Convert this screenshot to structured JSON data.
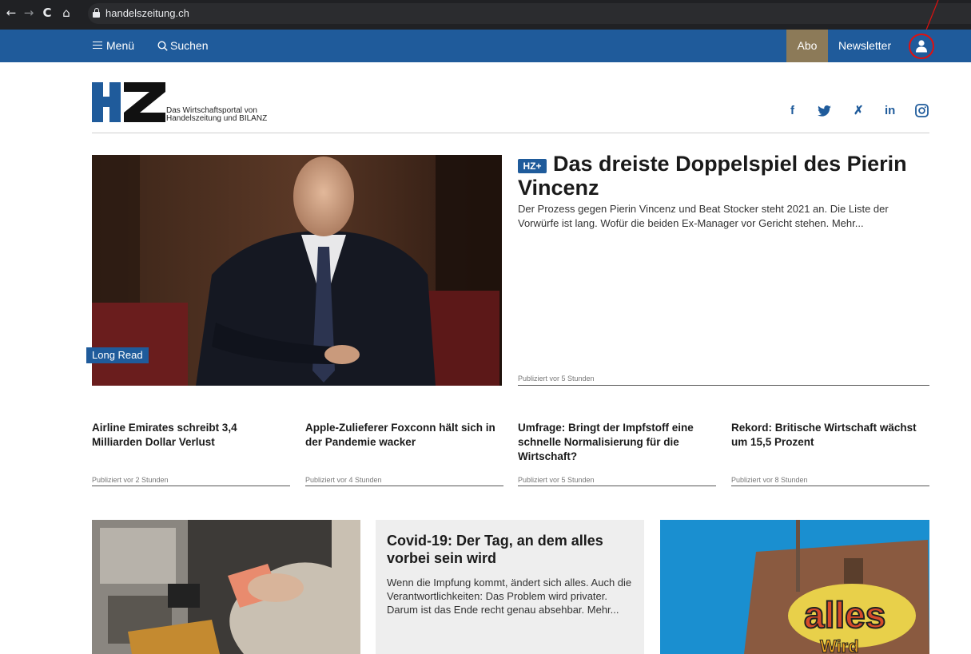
{
  "browser": {
    "url": "handelszeitung.ch",
    "back": "←",
    "forward": "→",
    "reload": "C",
    "home": "⌂"
  },
  "nav": {
    "menu": "Menü",
    "search": "Suchen",
    "abo": "Abo",
    "newsletter": "Newsletter"
  },
  "brand": {
    "logo_text": "HZ",
    "tagline_line1": "Das Wirtschaftsportal von",
    "tagline_line2": "Handelszeitung und BILANZ"
  },
  "social": {
    "facebook": "f",
    "twitter": "🐦",
    "xing": "✗",
    "linkedin": "in",
    "instagram": "◎"
  },
  "hero": {
    "badge": "Long Read",
    "premium_label": "HZ+",
    "title": "Das dreiste Doppelspiel des Pierin Vincenz",
    "lead": "Der Prozess gegen Pierin Vincenz und Beat Stocker steht 2021 an. Die Liste der Vorwürfe ist lang. Wofür die beiden Ex-Manager vor Gericht stehen. Mehr...",
    "published": "Publiziert vor 5 Stunden"
  },
  "articles": [
    {
      "title": "Airline Emirates schreibt 3,4 Milliarden Dollar Verlust",
      "published": "Publiziert vor 2 Stunden"
    },
    {
      "title": "Apple-Zulieferer Foxconn hält sich in der Pandemie wacker",
      "published": "Publiziert vor 4 Stunden"
    },
    {
      "title": "Umfrage: Bringt der Impfstoff eine schnelle Normalisierung für die Wirtschaft?",
      "published": "Publiziert vor 5 Stunden"
    },
    {
      "title": "Rekord: Britische Wirtschaft wächst um 15,5 Prozent",
      "published": "Publiziert vor 8 Stunden"
    }
  ],
  "covid": {
    "title": "Covid-19: Der Tag, an dem alles vorbei sein wird",
    "lead": "Wenn die Impfung kommt, ändert sich alles. Auch die Verantwortlichkeiten: Das Problem wird privater. Darum ist das Ende recht genau absehbar. Mehr..."
  },
  "graffiti": {
    "word1": "alles",
    "word2": "Wird"
  },
  "colors": {
    "brand_blue": "#1f5b9b",
    "abo_gold": "#8c7a58",
    "annotation_red": "#e01010"
  }
}
